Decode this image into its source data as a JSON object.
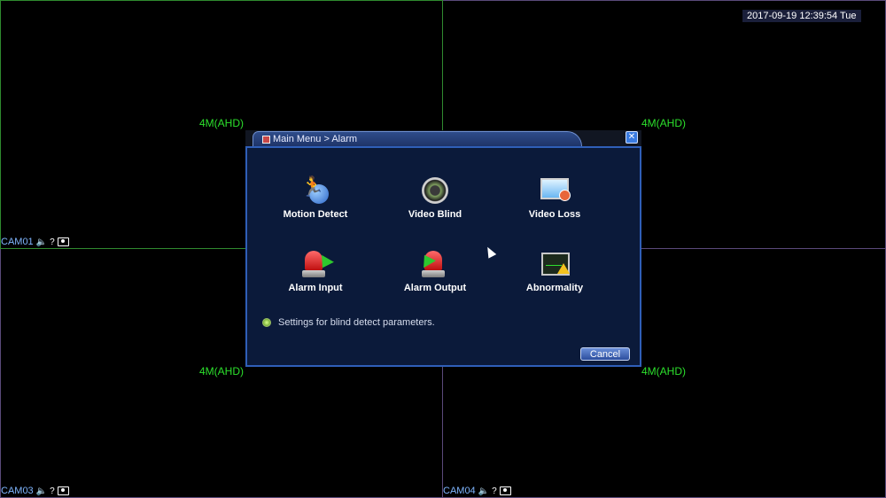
{
  "datetime": "2017-09-19 12:39:54 Tue",
  "cameras": [
    {
      "name": "CAM01",
      "resolution": "4M(AHD)"
    },
    {
      "name": "",
      "resolution": "4M(AHD)"
    },
    {
      "name": "CAM03",
      "resolution": "4M(AHD)"
    },
    {
      "name": "CAM04",
      "resolution": "4M(AHD)"
    }
  ],
  "dialog": {
    "title": "Main Menu > Alarm",
    "items": [
      {
        "label": "Motion Detect",
        "icon": "motion-detect-icon"
      },
      {
        "label": "Video Blind",
        "icon": "video-blind-icon"
      },
      {
        "label": "Video Loss",
        "icon": "video-loss-icon"
      },
      {
        "label": "Alarm Input",
        "icon": "alarm-input-icon"
      },
      {
        "label": "Alarm Output",
        "icon": "alarm-output-icon"
      },
      {
        "label": "Abnormality",
        "icon": "abnormality-icon"
      }
    ],
    "hint": "Settings for blind detect parameters.",
    "cancel_label": "Cancel",
    "close_label": "✕"
  },
  "colors": {
    "accent": "#2f5fb8",
    "label_green": "#2ce02c"
  }
}
